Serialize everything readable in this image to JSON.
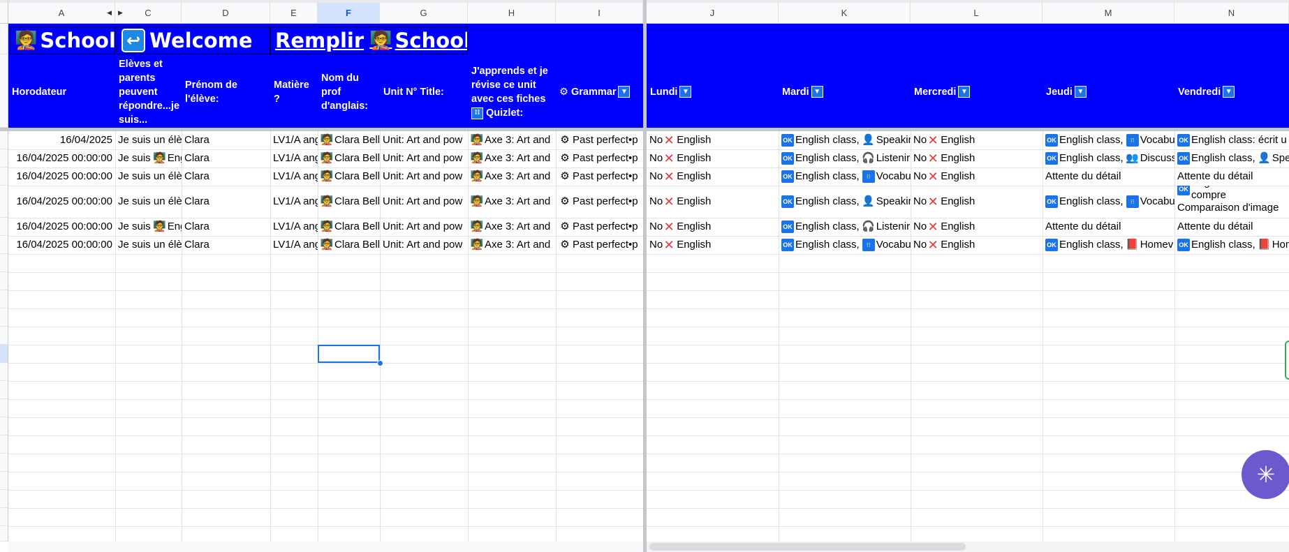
{
  "columns": [
    {
      "letter": "A"
    },
    {
      "letter": "C"
    },
    {
      "letter": "D"
    },
    {
      "letter": "E"
    },
    {
      "letter": "F"
    },
    {
      "letter": "G"
    },
    {
      "letter": "H"
    },
    {
      "letter": "I"
    },
    {
      "letter": "J"
    },
    {
      "letter": "K"
    },
    {
      "letter": "L"
    },
    {
      "letter": "M"
    },
    {
      "letter": "N"
    }
  ],
  "banner": {
    "school_label": "School",
    "welcome_label": "Welcome",
    "remplir_label": "Remplir",
    "school2_label": "School"
  },
  "headers": {
    "horodateur": "Horodateur",
    "eleves": "Elèves et parents peuvent répondre...je suis...",
    "prenom": "Prénom de l'élève:",
    "matiere": "Matière ?",
    "prof": "Nom du prof d'anglais:",
    "unit": "Unit N° Title:",
    "japprends": "J'apprends et je révise ce unit avec ces fiches",
    "quizlet": "Quizlet:",
    "grammar": "Grammar",
    "lundi": "Lundi",
    "mardi": "Mardi",
    "mercredi": "Mercredi",
    "jeudi": "Jeudi",
    "vendredi": "Vendredi"
  },
  "rows": [
    {
      "date": "16/04/2025",
      "eleve": "Je suis un élè",
      "prenom": "Clara",
      "matiere": "LV1/A ang",
      "prof": "Clara Bell",
      "unit": "Unit: Art and pow",
      "axe": "Axe 3: Art and",
      "grammar": "Past perfect•p",
      "lundi_no": "No",
      "lundi": "English",
      "mardi": "English class,",
      "mardi2": "Speakir",
      "mercredi_no": "No",
      "mercredi": "English",
      "jeudi": "English class,",
      "jeudi2": "Vocabu",
      "vendredi": "English class: écrit u"
    },
    {
      "date": "16/04/2025 00:00:00",
      "eleve": "Je suis",
      "eleve2": "Eng",
      "prenom": "Clara",
      "matiere": "LV1/A ang",
      "prof": "Clara Bell",
      "unit": "Unit: Art and pow",
      "axe": "Axe 3: Art and",
      "grammar": "Past perfect•p",
      "lundi_no": "No",
      "lundi": "English",
      "mardi": "English class,",
      "mardi2": "Listenir",
      "mercredi_no": "No",
      "mercredi": "English",
      "jeudi": "English class,",
      "jeudi2": "Discuss",
      "vendredi": "English class,",
      "vendredi2": "Spe"
    },
    {
      "date": "16/04/2025 00:00:00",
      "eleve": "Je suis un élè",
      "prenom": "Clara",
      "matiere": "LV1/A ang",
      "prof": "Clara Bell",
      "unit": "Unit: Art and pow",
      "axe": "Axe 3: Art and",
      "grammar": "Past perfect•p",
      "lundi_no": "No",
      "lundi": "English",
      "mardi": "English class,",
      "mardi2": "Vocabu",
      "mercredi_no": "No",
      "mercredi": "English",
      "jeudi_wait": "Attente du détail",
      "vendredi_wait": "Attente du détail"
    },
    {
      "date": "16/04/2025 00:00:00",
      "eleve": "Je suis un élè",
      "prenom": "Clara",
      "matiere": "LV1/A ang",
      "prof": "Clara Bell",
      "unit": "Unit: Art and pow",
      "axe": "Axe 3: Art and",
      "grammar": "Past perfect•p",
      "lundi_no": "No",
      "lundi": "English",
      "mardi": "English class,",
      "mardi2": "Speakir",
      "mercredi_no": "No",
      "mercredi": "English",
      "jeudi": "English class,",
      "jeudi2": "Vocabu",
      "vendredi": "English class: compre",
      "vendredi_l2": "Comparaison d'image su"
    },
    {
      "date": "16/04/2025 00:00:00",
      "eleve": "Je suis",
      "eleve2": "Eng",
      "prenom": "Clara",
      "matiere": "LV1/A ang",
      "prof": "Clara Bell",
      "unit": "Unit: Art and pow",
      "axe": "Axe 3: Art and",
      "grammar": "Past perfect•p",
      "lundi_no": "No",
      "lundi": "English",
      "mardi": "English class,",
      "mardi2": "Listenir",
      "mercredi_no": "No",
      "mercredi": "English",
      "jeudi_wait": "Attente du détail",
      "vendredi_wait": "Attente du détail"
    },
    {
      "date": "16/04/2025 00:00:00",
      "eleve": "Je suis un élè",
      "prenom": "Clara",
      "matiere": "LV1/A ang",
      "prof": "Clara Bell",
      "unit": "Unit: Art and pow",
      "axe": "Axe 3: Art and",
      "grammar": "Past perfect•p",
      "lundi_no": "No",
      "lundi": "English",
      "mardi": "English class,",
      "mardi2": "Vocabu",
      "mercredi_no": "No",
      "mercredi": "English",
      "jeudi": "English class,",
      "jeudi2": "Homev",
      "vendredi": "English class,",
      "vendredi2": "Hom"
    }
  ],
  "colors": {
    "banner": "#0000ff",
    "selection": "#1a73e8",
    "fab": "#6a5acd"
  }
}
